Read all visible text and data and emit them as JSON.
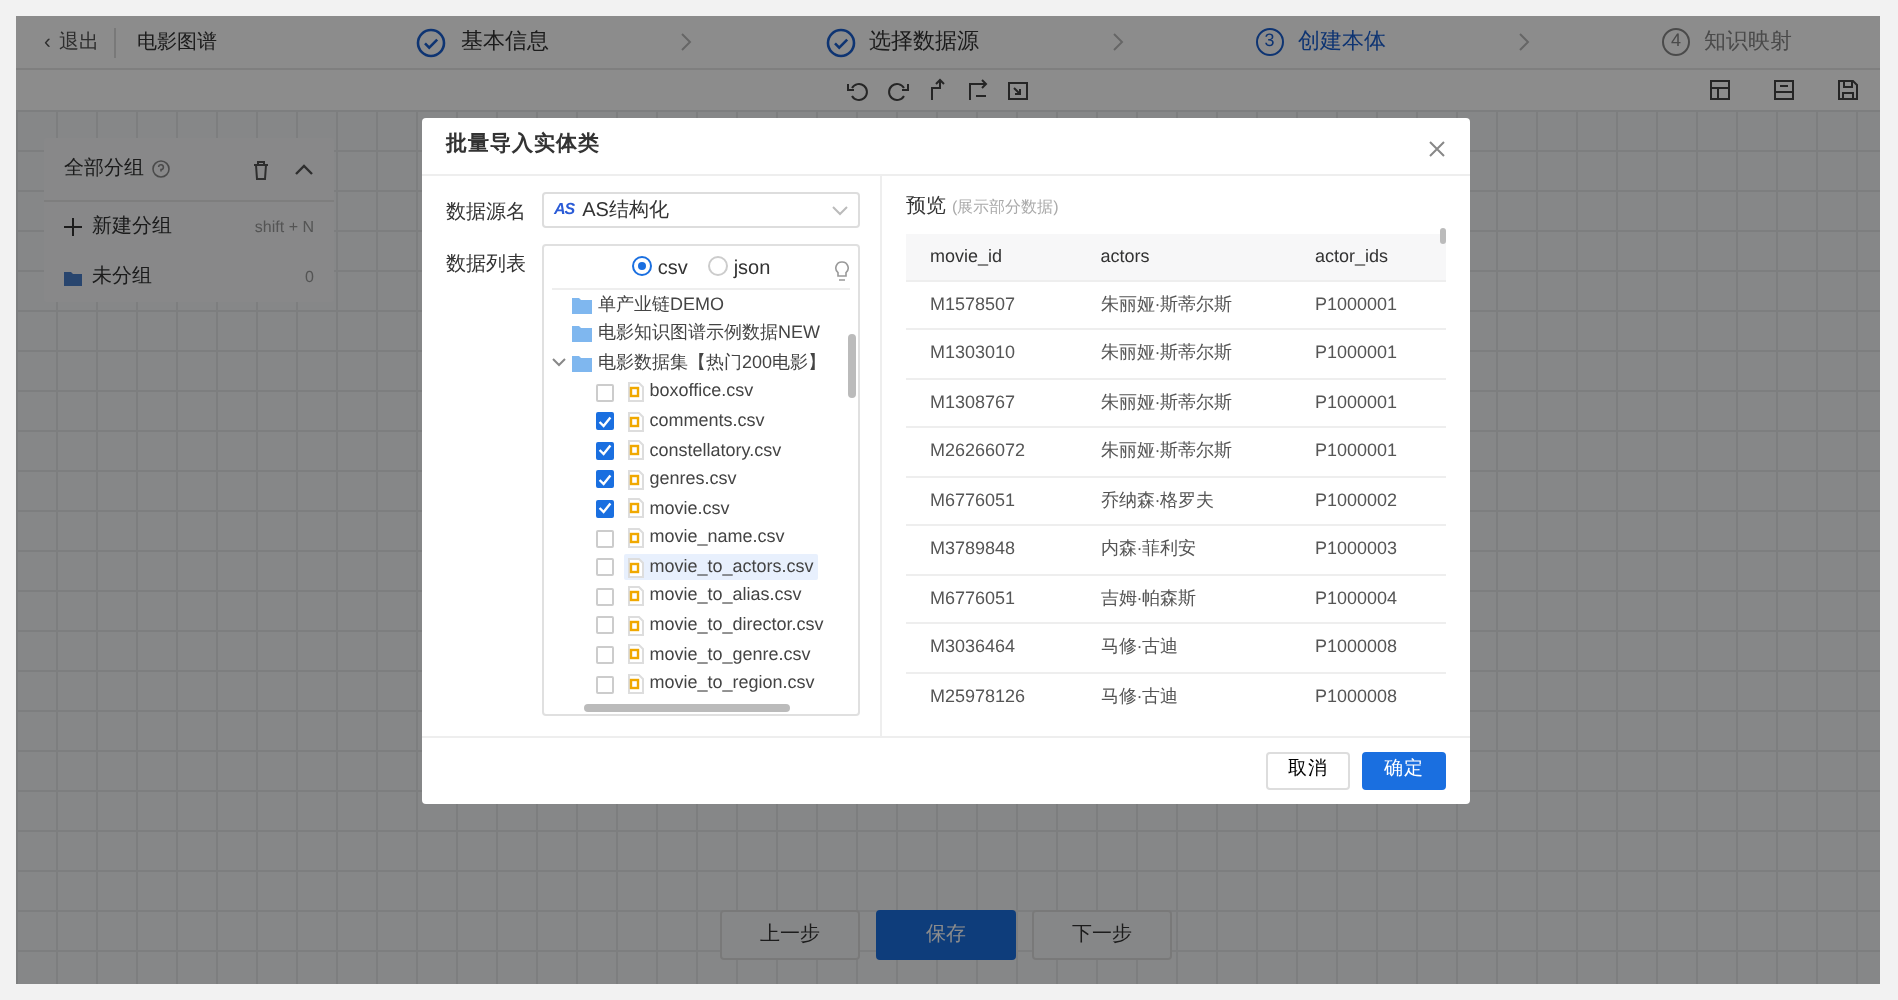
{
  "header": {
    "back": {
      "icon": "‹",
      "label": "退出"
    },
    "project_title": "电影图谱",
    "steps": [
      {
        "label": "基本信息",
        "kind": "done"
      },
      {
        "label": "选择数据源",
        "kind": "done"
      },
      {
        "number": "3",
        "label": "创建本体",
        "kind": "current"
      },
      {
        "number": "4",
        "label": "知识映射",
        "kind": "pending"
      }
    ]
  },
  "group_panel": {
    "title": "全部分组",
    "new_group": {
      "label": "新建分组",
      "shortcut": "shift + N"
    },
    "groups": [
      {
        "name": "未分组",
        "count": "0"
      }
    ]
  },
  "footer_buttons": [
    {
      "label": "上一步",
      "primary": false
    },
    {
      "label": "保存",
      "primary": true
    },
    {
      "label": "下一步",
      "primary": false
    }
  ],
  "dialog": {
    "title": "批量导入实体类",
    "source": {
      "label": "数据源名",
      "logo": "AS",
      "value": "AS结构化"
    },
    "list": {
      "label": "数据列表",
      "formats": [
        {
          "label": "csv",
          "selected": true
        },
        {
          "label": "json",
          "selected": false
        }
      ],
      "tree": [
        {
          "name": "单产业链DEMO",
          "expanded": false
        },
        {
          "name": "电影知识图谱示例数据NEW",
          "expanded": false
        },
        {
          "name": "电影数据集【热门200电影】",
          "expanded": true,
          "children": [
            {
              "name": "boxoffice.csv",
              "checked": false,
              "selected": false
            },
            {
              "name": "comments.csv",
              "checked": true,
              "selected": false
            },
            {
              "name": "constellatory.csv",
              "checked": true,
              "selected": false
            },
            {
              "name": "genres.csv",
              "checked": true,
              "selected": false
            },
            {
              "name": "movie.csv",
              "checked": true,
              "selected": false
            },
            {
              "name": "movie_name.csv",
              "checked": false,
              "selected": false
            },
            {
              "name": "movie_to_actors.csv",
              "checked": false,
              "selected": true
            },
            {
              "name": "movie_to_alias.csv",
              "checked": false,
              "selected": false
            },
            {
              "name": "movie_to_director.csv",
              "checked": false,
              "selected": false
            },
            {
              "name": "movie_to_genre.csv",
              "checked": false,
              "selected": false
            },
            {
              "name": "movie_to_region.csv",
              "checked": false,
              "selected": false
            }
          ]
        }
      ]
    },
    "preview": {
      "title": "预览",
      "hint": "(展示部分数据)",
      "columns": [
        "movie_id",
        "actors",
        "actor_ids"
      ],
      "rows": [
        [
          "M1578507",
          "朱丽娅·斯蒂尔斯",
          "P1000001"
        ],
        [
          "M1303010",
          "朱丽娅·斯蒂尔斯",
          "P1000001"
        ],
        [
          "M1308767",
          "朱丽娅·斯蒂尔斯",
          "P1000001"
        ],
        [
          "M26266072",
          "朱丽娅·斯蒂尔斯",
          "P1000001"
        ],
        [
          "M6776051",
          "乔纳森·格罗夫",
          "P1000002"
        ],
        [
          "M3789848",
          "内森·菲利安",
          "P1000003"
        ],
        [
          "M6776051",
          "吉姆·帕森斯",
          "P1000004"
        ],
        [
          "M3036464",
          "马修·古迪",
          "P1000008"
        ],
        [
          "M25978126",
          "马修·古迪",
          "P1000008"
        ]
      ]
    },
    "buttons": [
      {
        "label": "取消",
        "primary": false
      },
      {
        "label": "确定",
        "primary": true
      }
    ]
  }
}
